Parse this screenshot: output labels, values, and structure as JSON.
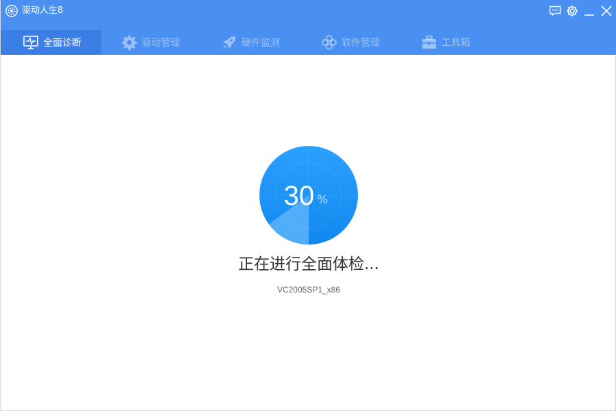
{
  "app": {
    "title": "驱动人生8",
    "logo_icon": "gear-logo-icon"
  },
  "window_controls": {
    "feedback_icon": "chat-icon",
    "settings_icon": "gear-icon",
    "minimize_icon": "minimize-icon",
    "close_icon": "close-icon"
  },
  "tabs": [
    {
      "label": "全面诊断",
      "icon": "monitor-pulse-icon",
      "active": true
    },
    {
      "label": "驱动管理",
      "icon": "gear-icon",
      "active": false
    },
    {
      "label": "硬件监测",
      "icon": "rocket-icon",
      "active": false
    },
    {
      "label": "软件管理",
      "icon": "flower-icon",
      "active": false
    },
    {
      "label": "工具箱",
      "icon": "toolbox-icon",
      "active": false
    }
  ],
  "scan": {
    "progress_value": "30",
    "progress_unit": "%",
    "progress_fraction": 0.3,
    "status": "正在进行全面体检...",
    "current_item": "VC2005SP1_x86"
  },
  "colors": {
    "titlebar": "#4a8ff2",
    "active_tab": "#3a7ee6",
    "circle_base": "#1e90f5",
    "circle_highlight": "#5aaef8"
  }
}
